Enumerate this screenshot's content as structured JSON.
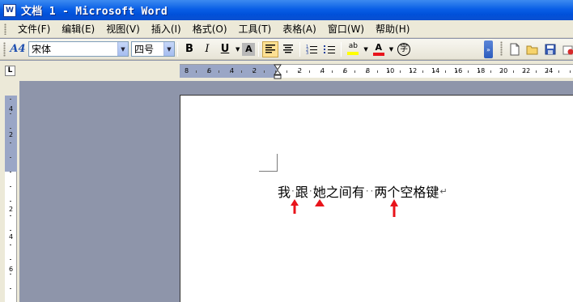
{
  "window": {
    "title": "文档 1 - Microsoft Word",
    "app_icon_label": "W"
  },
  "menubar": {
    "items": [
      "文件(F)",
      "编辑(E)",
      "视图(V)",
      "插入(I)",
      "格式(O)",
      "工具(T)",
      "表格(A)",
      "窗口(W)",
      "帮助(H)"
    ]
  },
  "toolbar": {
    "style_icon": "A4",
    "font_name": "宋体",
    "font_size": "四号",
    "bold_label": "B",
    "italic_label": "I",
    "underline_label": "U",
    "char_shading_label": "A",
    "highlight_label": "ab",
    "font_color_label": "A",
    "phonetic_label": "字"
  },
  "ruler": {
    "corner_label": "L",
    "left_ticks": [
      "8",
      "6",
      "4",
      "2"
    ],
    "right_ticks": [
      "2",
      "4",
      "6",
      "8",
      "10",
      "12",
      "14",
      "16",
      "18",
      "20",
      "22",
      "24"
    ],
    "vertical_ticks": [
      "4",
      "2",
      "2",
      "4",
      "6"
    ]
  },
  "document": {
    "segments": [
      {
        "text": "我",
        "space_after": 1
      },
      {
        "text": "跟",
        "space_after": 1
      },
      {
        "text": "她之间有",
        "space_after": 2
      },
      {
        "text": "两个空格键",
        "space_after": 0
      }
    ],
    "space_marker": "·",
    "paragraph_mark": "↵"
  },
  "annotations": {
    "arrow_color": "#e8141b"
  },
  "colors": {
    "titlebar": "#0a5fe6",
    "chrome": "#ece9d8",
    "workspace": "#8e95aa",
    "active_button": "#fde093"
  }
}
